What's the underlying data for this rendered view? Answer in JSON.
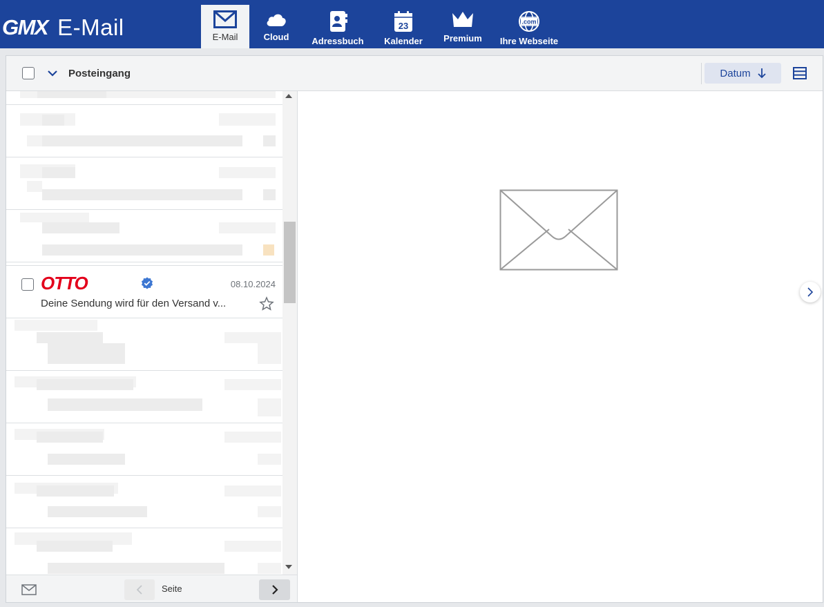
{
  "app": {
    "brand": "GMX",
    "product": "E-Mail",
    "brand_color": "#1c449b"
  },
  "nav": {
    "items": [
      {
        "label": "E-Mail",
        "icon": "envelope-icon",
        "active": true
      },
      {
        "label": "Cloud",
        "icon": "cloud-icon"
      },
      {
        "label": "Adressbuch",
        "icon": "address-book-icon"
      },
      {
        "label": "Kalender",
        "icon": "calendar-icon",
        "badge": "23"
      },
      {
        "label": "Premium",
        "icon": "crown-icon"
      },
      {
        "label": "Ihre Webseite",
        "icon": "globe-icon",
        "badge": ".com"
      }
    ]
  },
  "mailbox": {
    "folder": "Posteingang",
    "sort_label": "Datum",
    "sort_direction_icon": "arrow-down-icon"
  },
  "emails": [
    {
      "sender_logo_text": "OTTO",
      "verified": true,
      "date": "08.10.2024",
      "subject": "Deine Sendung wird für den Versand v..."
    }
  ],
  "pagination": {
    "label": "Seite"
  }
}
